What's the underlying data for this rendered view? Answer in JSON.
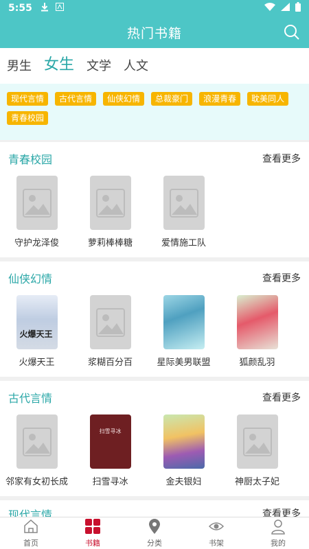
{
  "status_bar": {
    "time": "5:55"
  },
  "app_bar": {
    "title": "热门书籍"
  },
  "tabs": [
    {
      "label": "男生"
    },
    {
      "label": "女生"
    },
    {
      "label": "文学"
    },
    {
      "label": "人文"
    }
  ],
  "tags": [
    "现代言情",
    "古代言情",
    "仙侠幻情",
    "总裁豪门",
    "浪漫青春",
    "耽美同人",
    "青春校园"
  ],
  "sections": [
    {
      "title": "青春校园",
      "more": "查看更多",
      "books": [
        {
          "title": "守护龙泽俊"
        },
        {
          "title": "萝莉棒棒糖"
        },
        {
          "title": "爱情施工队"
        }
      ]
    },
    {
      "title": "仙侠幻情",
      "more": "查看更多",
      "books": [
        {
          "title": "火爆天王",
          "cover_text": "火爆天王"
        },
        {
          "title": "浆糊百分百"
        },
        {
          "title": "星际美男联盟"
        },
        {
          "title": "狐颜乱羽"
        }
      ]
    },
    {
      "title": "古代言情",
      "more": "查看更多",
      "books": [
        {
          "title": "邻家有女初长成"
        },
        {
          "title": "扫雪寻冰",
          "cover_text": "扫雪寻冰"
        },
        {
          "title": "金夫银妇"
        },
        {
          "title": "神厨太子妃"
        }
      ]
    },
    {
      "title": "现代言情",
      "more": "查看更多"
    }
  ],
  "bottom_nav": [
    {
      "label": "首页"
    },
    {
      "label": "书籍"
    },
    {
      "label": "分类"
    },
    {
      "label": "书架"
    },
    {
      "label": "我的"
    }
  ],
  "colors": {
    "primary": "#4dc6c6",
    "accent_text": "#2aa7a7",
    "tag": "#f7b500",
    "nav_active": "#c8102e"
  }
}
